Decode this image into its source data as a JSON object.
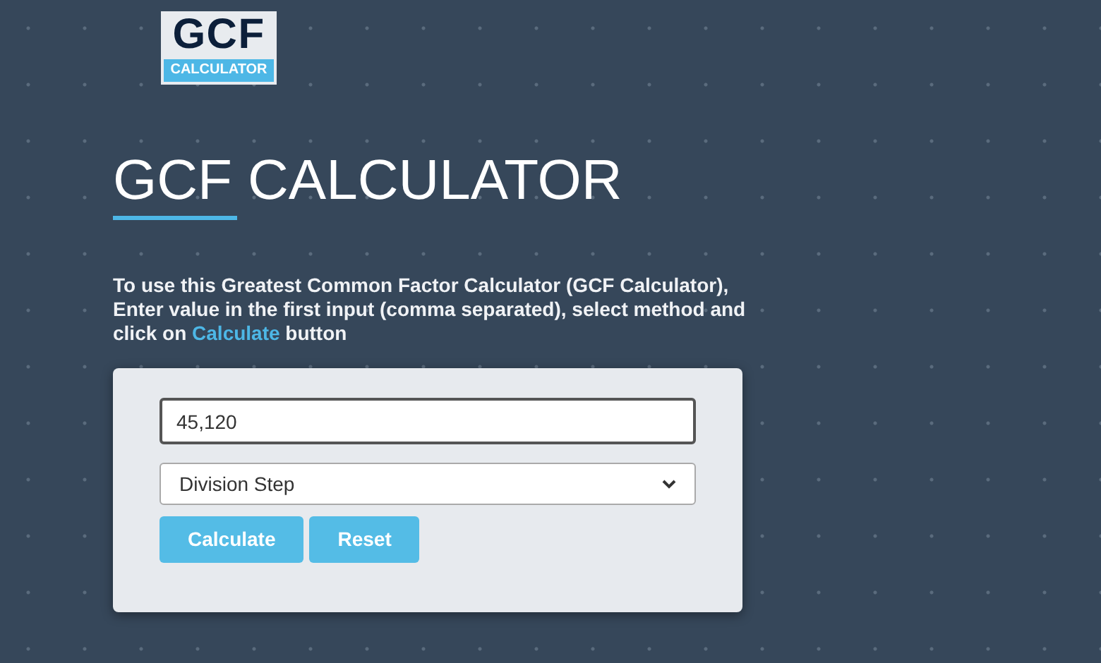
{
  "logo": {
    "top": "GCF",
    "bottom": "CALCULATOR"
  },
  "title": "GCF CALCULATOR",
  "intro": {
    "before": "To use this Greatest Common Factor Calculator (GCF Calculator), Enter value in the first input (comma separated), select method and click on ",
    "link": "Calculate",
    "after": " button"
  },
  "form": {
    "numbers": {
      "value": "45,120"
    },
    "method": {
      "value": "Division Step"
    },
    "buttons": [
      "Calculate",
      "Reset"
    ]
  }
}
